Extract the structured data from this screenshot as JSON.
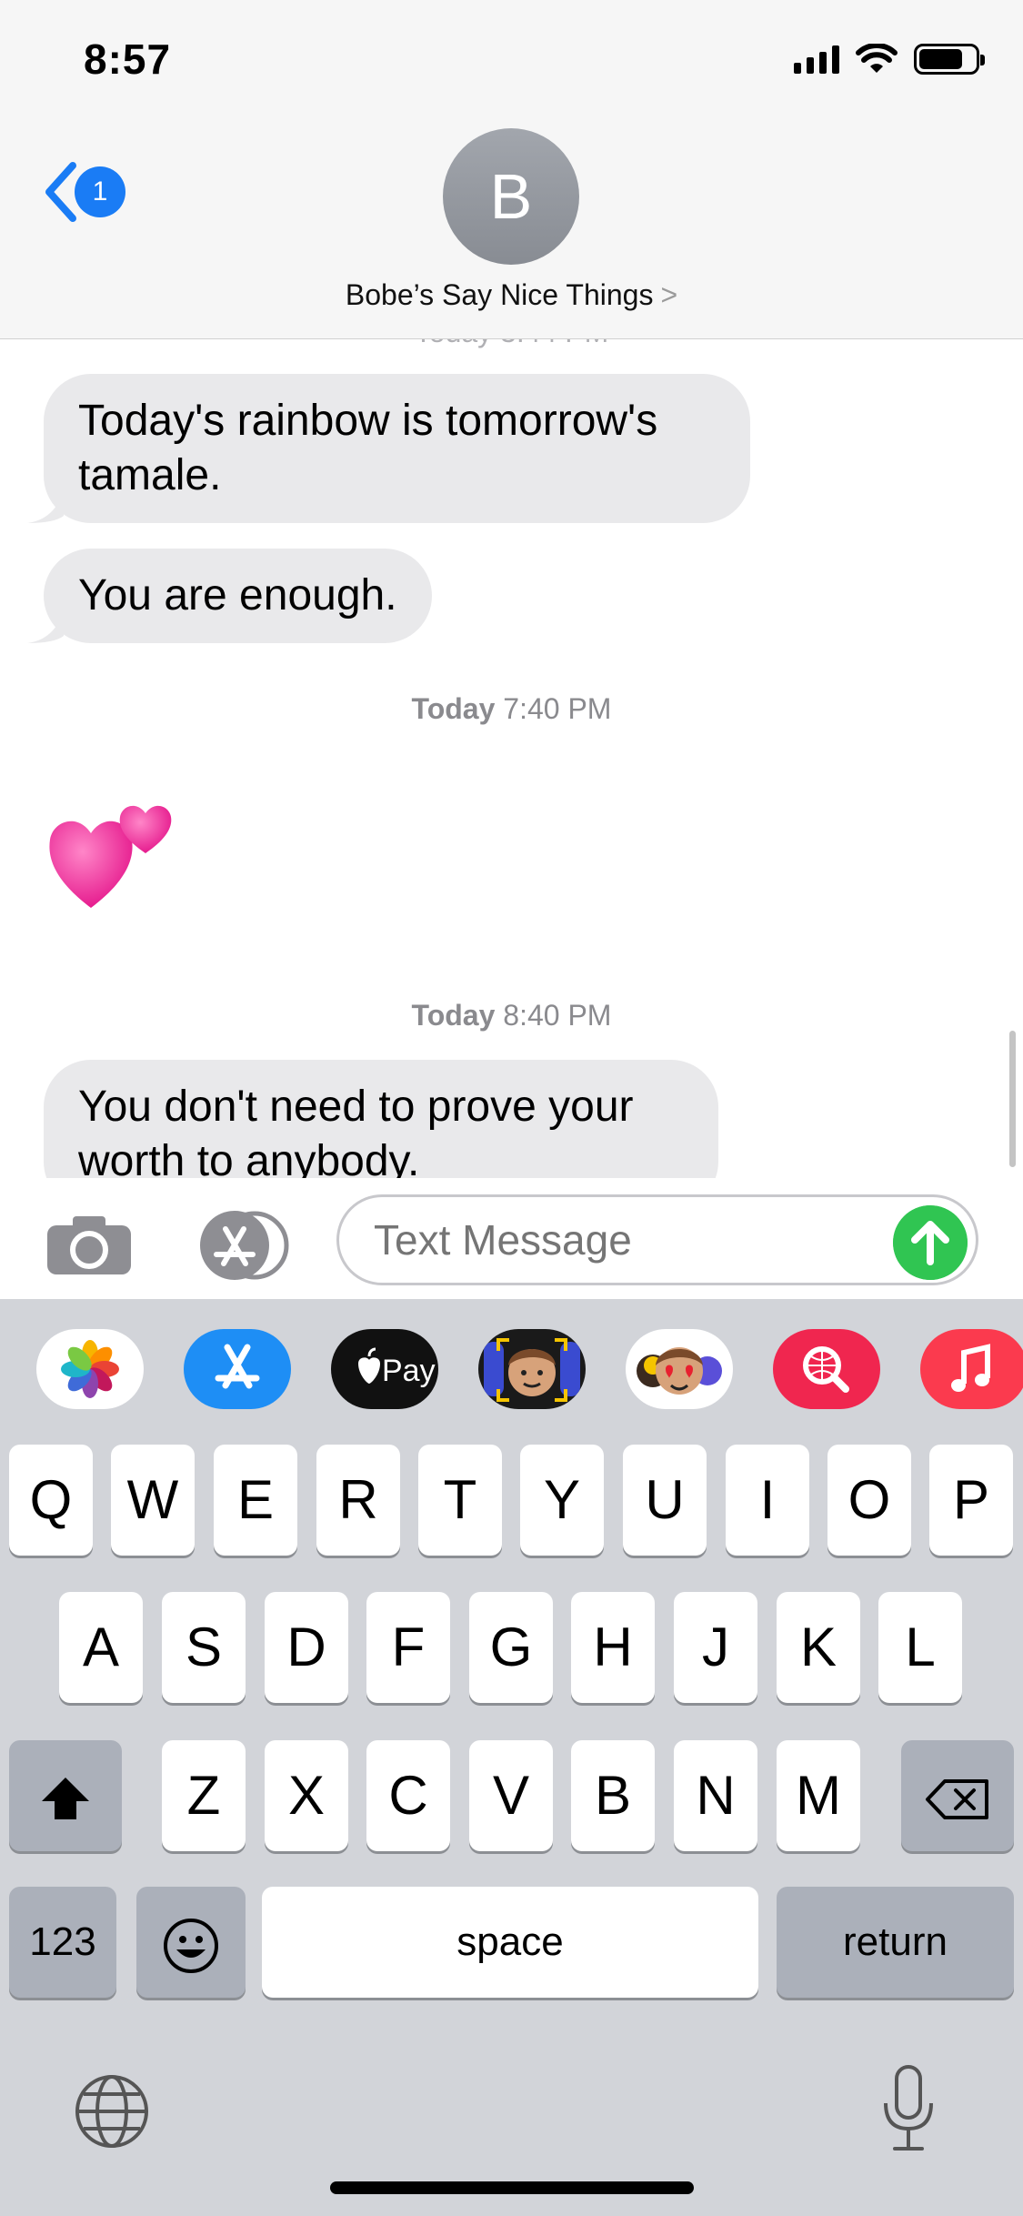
{
  "status": {
    "time": "8:57"
  },
  "nav": {
    "back_badge": "1",
    "avatar_initial": "B",
    "contact_name": "Bobe’s Say Nice Things",
    "chevron": ">"
  },
  "thread": {
    "messages": [
      {
        "type": "incoming",
        "lines": [
          "Today's rainbow is tomorrow's",
          "tamale."
        ]
      },
      {
        "type": "incoming",
        "lines": [
          "You are enough."
        ]
      },
      {
        "type": "timestamp",
        "day": "Today",
        "time": "7:40 PM"
      },
      {
        "type": "emoji",
        "name": "two-hearts"
      },
      {
        "type": "timestamp",
        "day": "Today",
        "time": "8:40 PM"
      },
      {
        "type": "incoming",
        "lines": [
          "You don't need to prove your",
          "worth to anybody."
        ]
      }
    ]
  },
  "input": {
    "placeholder": "Text Message"
  },
  "app_drawer": [
    "photos",
    "app-store",
    "apple-pay",
    "memoji",
    "animoji-stickers",
    "images-search",
    "music"
  ],
  "apple_pay_label": "Pay",
  "keyboard": {
    "row1": [
      "Q",
      "W",
      "E",
      "R",
      "T",
      "Y",
      "U",
      "I",
      "O",
      "P"
    ],
    "row2": [
      "A",
      "S",
      "D",
      "F",
      "G",
      "H",
      "J",
      "K",
      "L"
    ],
    "row3": [
      "Z",
      "X",
      "C",
      "V",
      "B",
      "N",
      "M"
    ],
    "numbers": "123",
    "space": "space",
    "return": "return"
  },
  "colors": {
    "accent": "#1a7cf5",
    "send": "#30c552",
    "bubble": "#e9e9eb",
    "keyboard_bg": "#d2d4d9"
  }
}
